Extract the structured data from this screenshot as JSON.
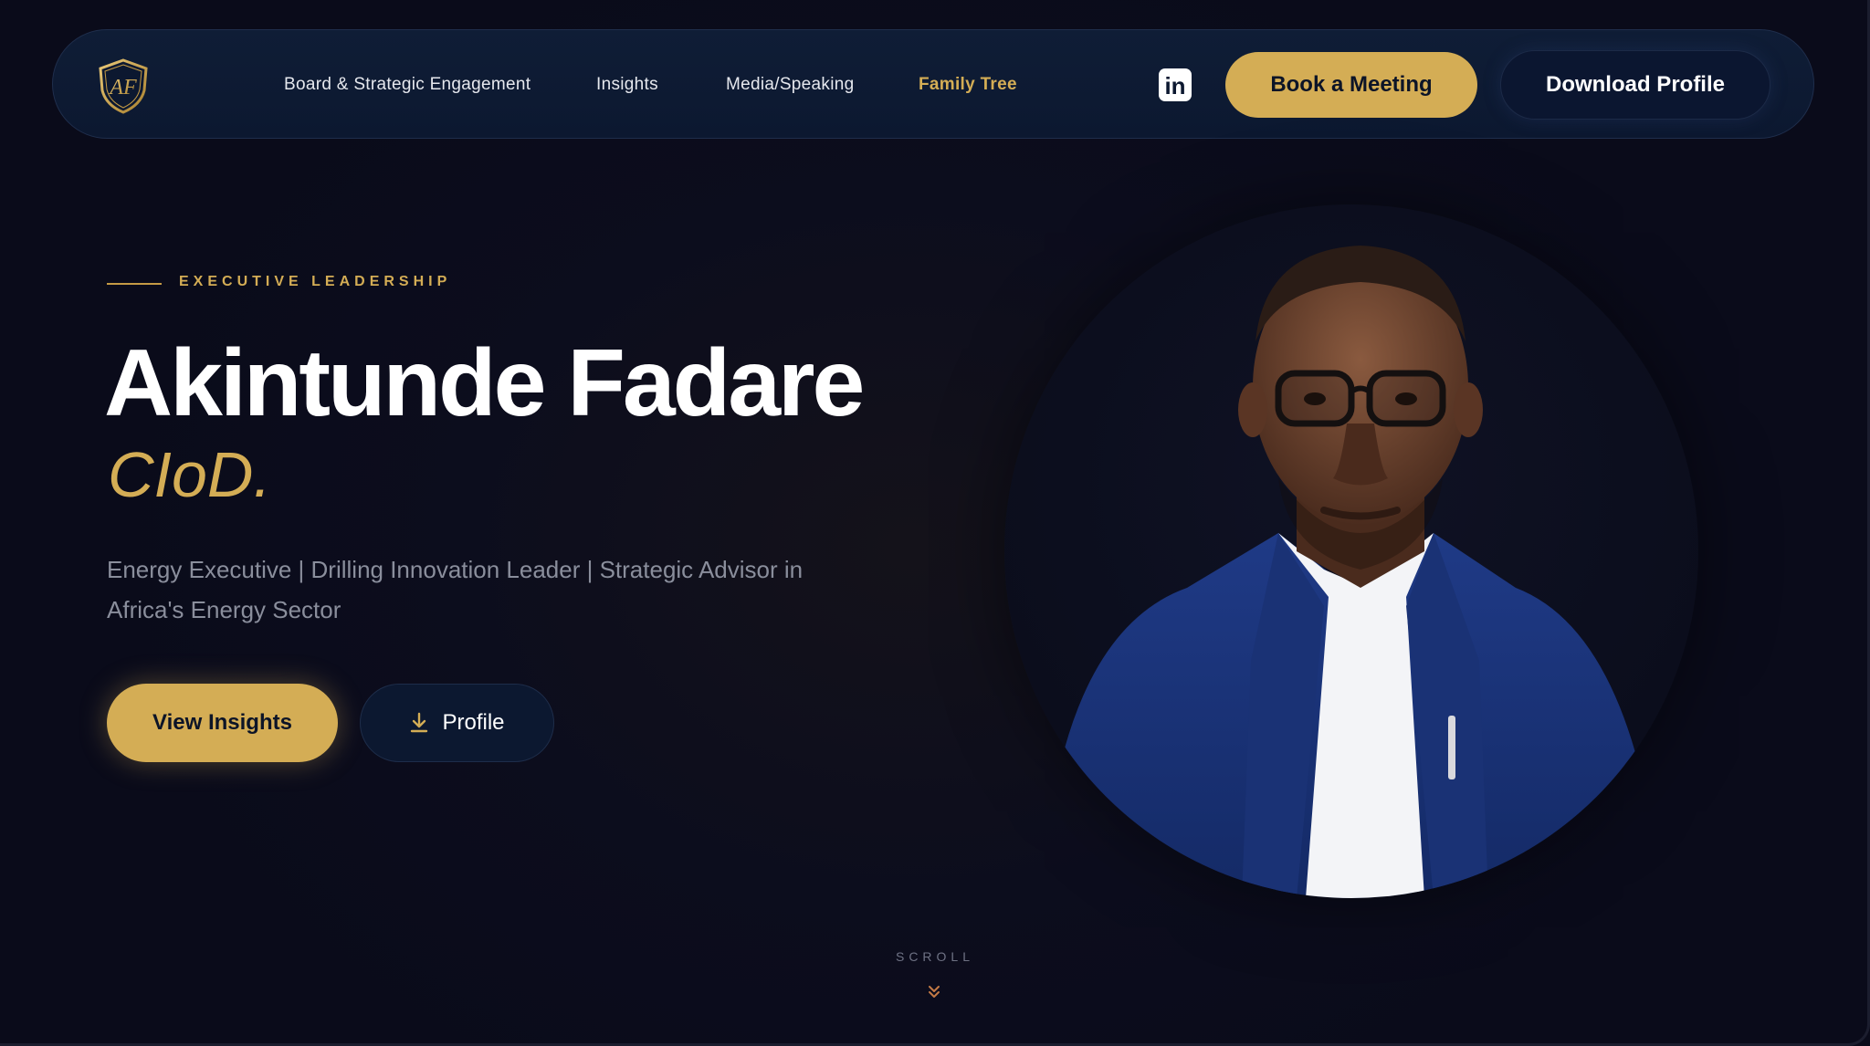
{
  "nav": {
    "logo_text": "AF",
    "links": [
      {
        "label": "Board & Strategic Engagement",
        "active": false
      },
      {
        "label": "Insights",
        "active": false
      },
      {
        "label": "Media/Speaking",
        "active": false
      },
      {
        "label": "Family Tree",
        "active": true
      }
    ],
    "linkedin_icon": "linkedin-icon",
    "book_label": "Book a Meeting",
    "download_label": "Download Profile"
  },
  "hero": {
    "eyebrow": "EXECUTIVE LEADERSHIP",
    "name": "Akintunde Fadare",
    "postnominal": "CIoD.",
    "tagline": "Energy Executive | Drilling Innovation Leader | Strategic Advisor in Africa's Energy Sector",
    "primary_cta": "View Insights",
    "secondary_cta": "Profile",
    "secondary_cta_icon": "download-icon",
    "portrait_alt": "portrait-photo"
  },
  "scroll": {
    "label": "SCROLL",
    "icon": "double-chevron-down-icon"
  },
  "colors": {
    "background": "#0a0b1a",
    "nav_bg": "#0f1d36",
    "accent_gold": "#d4ad55",
    "muted_text": "#8a8e9c"
  }
}
